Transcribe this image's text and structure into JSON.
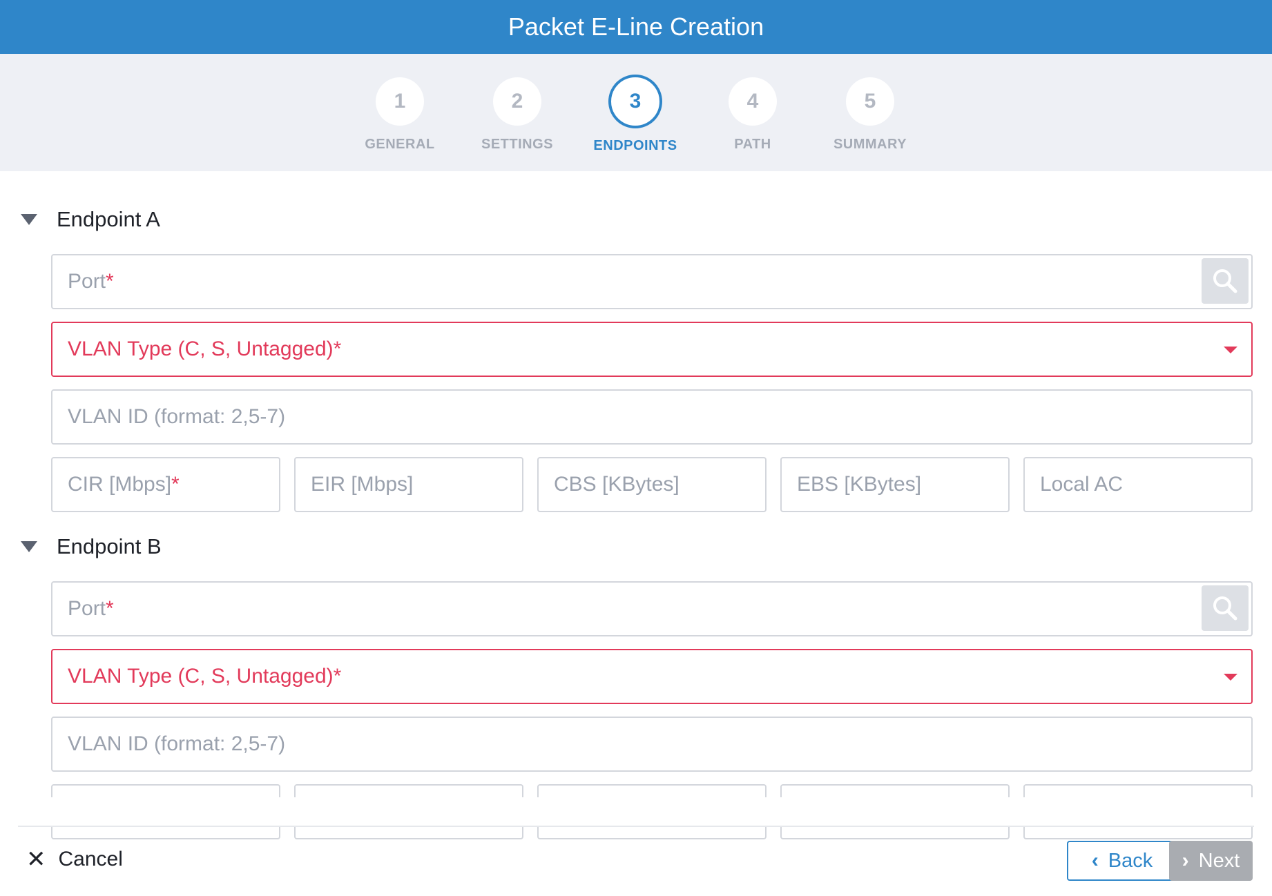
{
  "header": {
    "title": "Packet E-Line Creation"
  },
  "steps": [
    {
      "number": "1",
      "label": "GENERAL"
    },
    {
      "number": "2",
      "label": "SETTINGS"
    },
    {
      "number": "3",
      "label": "ENDPOINTS"
    },
    {
      "number": "4",
      "label": "PATH"
    },
    {
      "number": "5",
      "label": "SUMMARY"
    }
  ],
  "active_step": 3,
  "endpoint_a": {
    "title": "Endpoint A",
    "port_placeholder": "Port",
    "vlan_type_placeholder": "VLAN Type (C, S, Untagged)*",
    "vlan_id_placeholder": "VLAN ID (format: 2,5-7)",
    "cir_placeholder": "CIR [Mbps]",
    "eir_placeholder": "EIR [Mbps]",
    "cbs_placeholder": "CBS [KBytes]",
    "ebs_placeholder": "EBS [KBytes]",
    "local_ac_placeholder": "Local AC"
  },
  "endpoint_b": {
    "title": "Endpoint B",
    "port_placeholder": "Port",
    "vlan_type_placeholder": "VLAN Type (C, S, Untagged)*",
    "vlan_id_placeholder": "VLAN ID (format: 2,5-7)"
  },
  "required_mark": "*",
  "footer": {
    "cancel_label": "Cancel",
    "back_label": "Back",
    "next_label": "Next"
  },
  "colors": {
    "primary": "#2f86c9",
    "error": "#e23a5a",
    "disabled": "#a9acb1"
  }
}
